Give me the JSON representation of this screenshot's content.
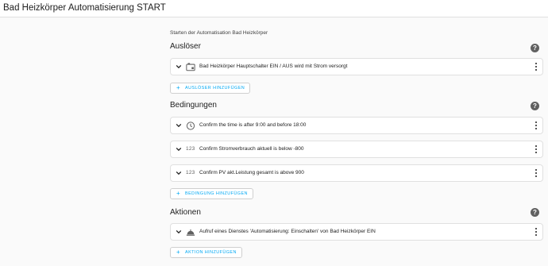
{
  "header": {
    "title": "Bad Heizkörper Automatisierung START"
  },
  "description": "Starten der Automatisation Bad Heizkörper",
  "sections": {
    "triggers": {
      "title": "Auslöser",
      "items": [
        {
          "icon": "device-icon",
          "label": "Bad Heizkörper Hauptschalter EIN / AUS wird mit Strom versorgt"
        }
      ],
      "add_label": "AUSLÖSER HINZUFÜGEN"
    },
    "conditions": {
      "title": "Bedingungen",
      "items": [
        {
          "icon": "clock-icon",
          "label": "Confirm the time is after 9:00 and before 18:00"
        },
        {
          "icon": "numeric-icon",
          "icon_text": "123",
          "label": "Confirm Stromverbrauch aktuell is below -800"
        },
        {
          "icon": "numeric-icon",
          "icon_text": "123",
          "label": "Confirm PV akt.Leistung gesamt is above 900"
        }
      ],
      "add_label": "BEDINGUNG HINZUFÜGEN"
    },
    "actions": {
      "title": "Aktionen",
      "items": [
        {
          "icon": "service-icon",
          "label": "Aufruf eines Dienstes 'Automatisierung: Einschalten' von Bad Heizkörper EIN"
        }
      ],
      "add_label": "AKTION HINZUFÜGEN"
    }
  },
  "colors": {
    "accent": "#03a9f4",
    "help_icon": "#616161",
    "border": "#e0e0e0"
  }
}
